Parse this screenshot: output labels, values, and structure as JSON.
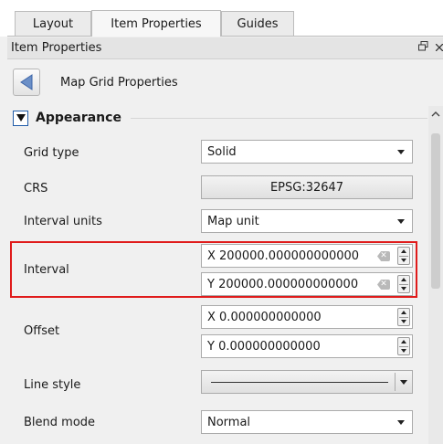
{
  "tabs": [
    {
      "label": "Layout",
      "active": false
    },
    {
      "label": "Item Properties",
      "active": true
    },
    {
      "label": "Guides",
      "active": false
    }
  ],
  "dock": {
    "title": "Item Properties",
    "icons": [
      "float-icon",
      "close-icon"
    ]
  },
  "back": {
    "label": "Map Grid Properties",
    "icon": "left-triangle-icon"
  },
  "section": {
    "title": "Appearance",
    "expanded": true
  },
  "fields": {
    "grid_type": {
      "label": "Grid type",
      "value": "Solid"
    },
    "crs": {
      "label": "CRS",
      "value": "EPSG:32647"
    },
    "interval_units": {
      "label": "Interval units",
      "value": "Map unit"
    },
    "interval": {
      "label": "Interval",
      "x": "X 200000.000000000000",
      "y": "Y 200000.000000000000"
    },
    "offset": {
      "label": "Offset",
      "x": "X 0.000000000000",
      "y": "Y 0.000000000000"
    },
    "line_style": {
      "label": "Line style"
    },
    "blend_mode": {
      "label": "Blend mode",
      "value": "Normal"
    }
  },
  "colors": {
    "highlight": "#e01b1b",
    "back_arrow": "#6b8fc7",
    "check_accent": "#1f5ba8"
  }
}
